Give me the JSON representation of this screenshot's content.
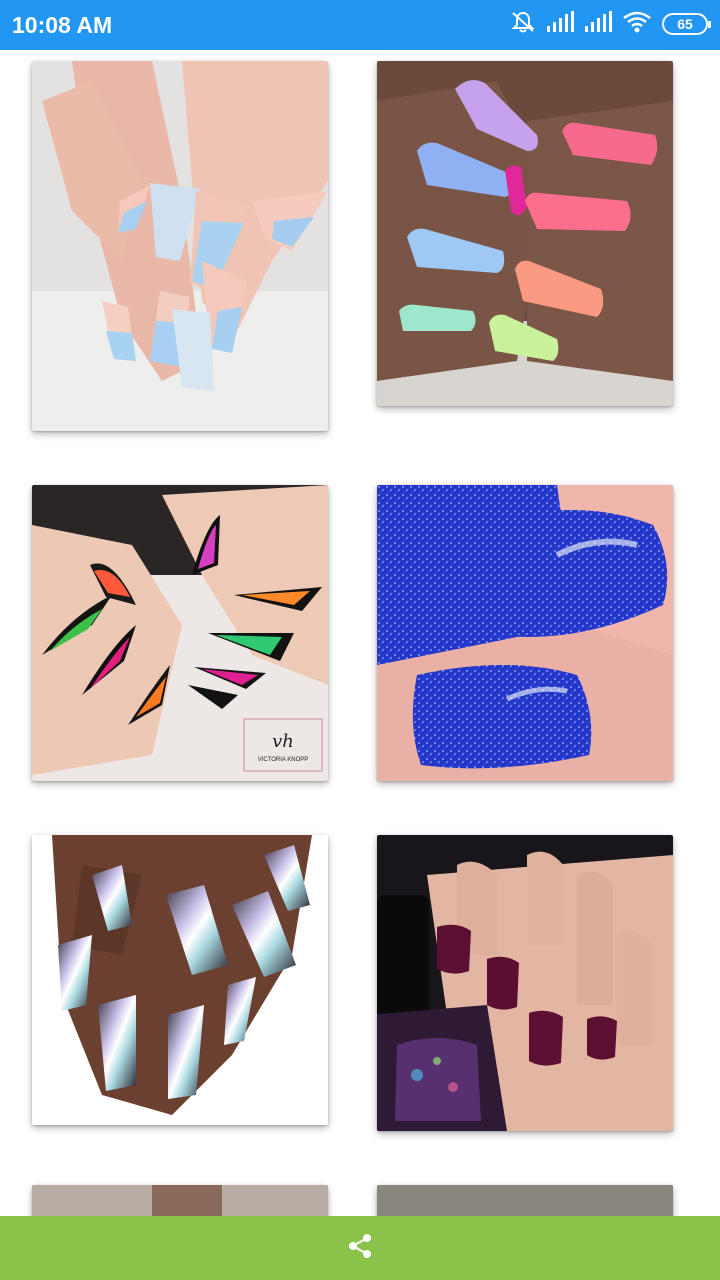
{
  "status_bar": {
    "time": "10:08 AM",
    "battery": "65",
    "icons": [
      "mute-icon",
      "signal-icon",
      "signal-icon",
      "wifi-icon",
      "battery-icon"
    ]
  },
  "gallery": {
    "images": [
      {
        "name": "nail-image-ombre-blue",
        "watermark": ""
      },
      {
        "name": "nail-image-pastel-colors",
        "watermark": ""
      },
      {
        "name": "nail-image-flame-stiletto",
        "watermark": "VICTORIA KNOPP"
      },
      {
        "name": "nail-image-blue-glitter",
        "watermark": ""
      },
      {
        "name": "nail-image-holographic-chrome",
        "watermark": ""
      },
      {
        "name": "nail-image-purple-glitter",
        "watermark": ""
      },
      {
        "name": "nail-image-partial-left",
        "watermark": ""
      },
      {
        "name": "nail-image-partial-right",
        "watermark": ""
      }
    ]
  },
  "bottom_bar": {
    "share_icon": "share-icon",
    "color": "#8BC34A"
  },
  "colors": {
    "status_bar": "#2196F3",
    "bottom_bar": "#8BC34A"
  }
}
